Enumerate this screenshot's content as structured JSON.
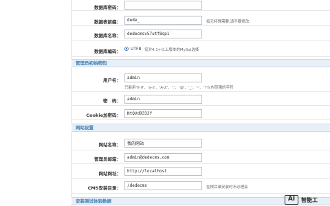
{
  "db": {
    "password_label": "数据库密码：",
    "password_value": "",
    "prefix_label": "数据表前缀：",
    "prefix_value": "dede_",
    "prefix_hint": "如无特殊需要,请不要修改",
    "name_label": "数据库名称：",
    "name_value": "dedecmsv57utf8sp1",
    "charset_label": "数据库编码：",
    "charset_value": "UTF8",
    "charset_hint": "仅对4.1+以上版本的MySql选择"
  },
  "admin_section": {
    "title": "管理员初始密码",
    "username_label": "用户名：",
    "username_value": "admin",
    "username_hint": "只能用'0-9'、'a-z'、'A-Z'、'.'、'@'、'_'、'-'、'!'以内范围的字符",
    "password_label": "密　码：",
    "password_value": "admin",
    "cookie_label": "Cookie加密码：",
    "cookie_value": "NtQVd9332Y"
  },
  "site_section": {
    "title": "网站设置",
    "sitename_label": "网站名称：",
    "sitename_value": "我的网站",
    "email_label": "管理员邮箱：",
    "email_value": "admin@dedecms.com",
    "url_label": "网站网址：",
    "url_value": "http://localhost",
    "dir_label": "CMS安装目录：",
    "dir_value": "/dedecms",
    "dir_hint": "在根目录安装时不必理会"
  },
  "test_section": {
    "title": "安装测试体验数据"
  },
  "watermark": {
    "badge": "AI",
    "text": "智能工"
  }
}
